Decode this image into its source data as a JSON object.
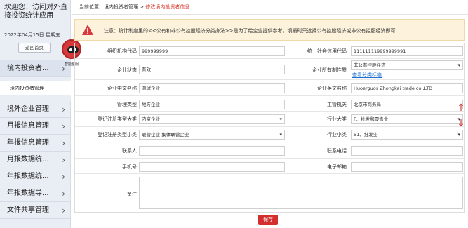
{
  "sidebar": {
    "welcome": "欢迎您！访问对外直接投资统计应用",
    "datetime": "2022年04月15日 星期五",
    "home_button": "返回首页",
    "items": [
      {
        "label": "境内投资者..."
      },
      {
        "label": "境内投资者管理"
      },
      {
        "label": "境外企业管理"
      },
      {
        "label": "月报信息管理"
      },
      {
        "label": "年报信息管理"
      },
      {
        "label": "月报数据统..."
      },
      {
        "label": "年报数据统..."
      },
      {
        "label": "年报数据导..."
      },
      {
        "label": "文件共享管理"
      }
    ],
    "arrow": "›",
    "robot_label": "智能客服"
  },
  "breadcrumb": {
    "prefix": "当前位置：",
    "parent": "境内投资者管理",
    "separator": " > ",
    "current": "修改境内投资者信息"
  },
  "notice": "注意：统计制度里的<<公有和非公有控股经济分类办法>>是为了给企业提供参考，填报时只选择公有控股经济或非公有控股经济即可",
  "form": {
    "org_code": {
      "label": "组织机构代码",
      "value": "999999999"
    },
    "credit_code": {
      "label": "统一社会信用代码",
      "value": "111111119999999991"
    },
    "status": {
      "label": "企业状态",
      "value": "有效"
    },
    "ownership": {
      "label": "企业所有制性质",
      "value": "非公有控股经济",
      "link": "查看分类标准"
    },
    "cn_name": {
      "label": "企业中文名称",
      "value": "测试企业"
    },
    "en_name": {
      "label": "企业英文名称",
      "value": "Huoerguos Zhongkai trade co.,LTD"
    },
    "mgmt_type": {
      "label": "管理类型",
      "value": "地方企业"
    },
    "authority": {
      "label": "主管机关",
      "value": "北京市商务局"
    },
    "reg_type_major": {
      "label": "登记注册类型大类",
      "value": "内资企业"
    },
    "industry_major": {
      "label": "行业大类",
      "value": "F、批发和零售业"
    },
    "reg_type_minor": {
      "label": "登记注册类型小类",
      "value": "联营企业-集体联营企业"
    },
    "industry_minor": {
      "label": "行业小类",
      "value": "51、批发业"
    },
    "contact": {
      "label": "联系人",
      "value": ""
    },
    "phone": {
      "label": "联系电话",
      "value": ""
    },
    "mobile": {
      "label": "手机号",
      "value": ""
    },
    "email": {
      "label": "电子邮箱",
      "value": ""
    },
    "remarks": {
      "label": "备注",
      "value": ""
    }
  },
  "save_button": "保存",
  "side_arrows": {
    "up": "↑",
    "down": "↓"
  },
  "colors": {
    "accent": "#d32f2f",
    "link": "#1a6fd0",
    "notice_bg": "#fdf3dc"
  }
}
